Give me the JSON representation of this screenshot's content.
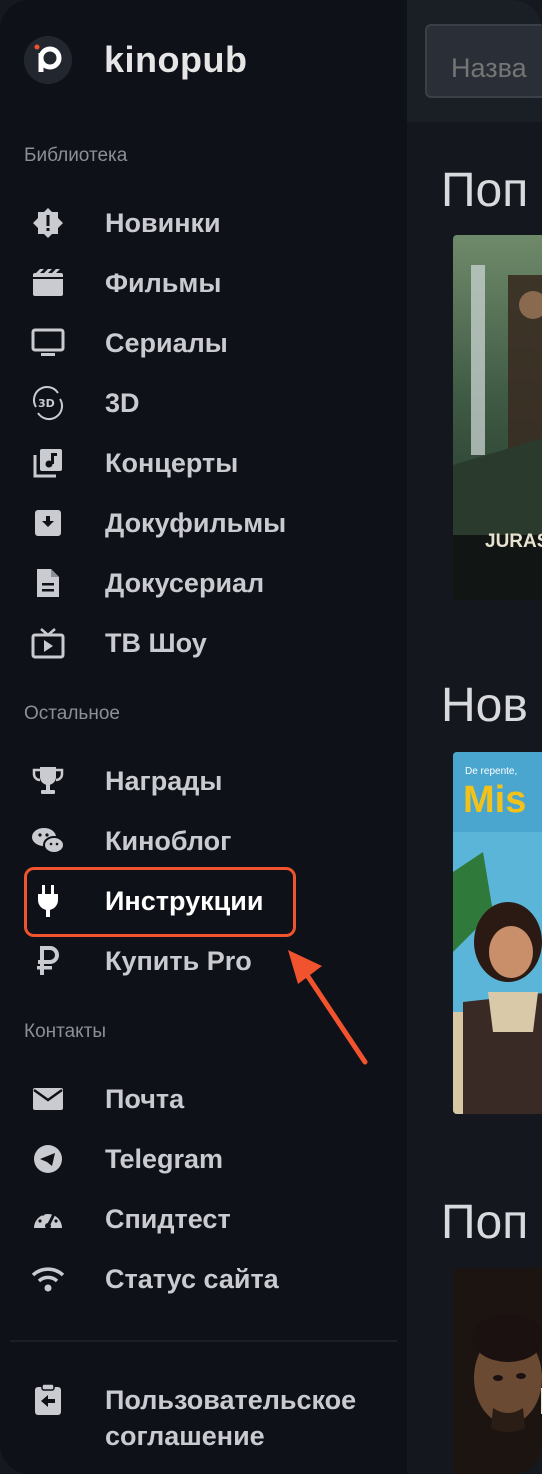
{
  "app": {
    "name": "kinopub"
  },
  "search": {
    "placeholder": "Назва"
  },
  "sections": {
    "library_title": "Библиотека",
    "other_title": "Остальное",
    "contacts_title": "Контакты"
  },
  "library": [
    {
      "label": "Новинки",
      "icon": "badge-alert-icon"
    },
    {
      "label": "Фильмы",
      "icon": "clapperboard-icon"
    },
    {
      "label": "Сериалы",
      "icon": "tv-monitor-icon"
    },
    {
      "label": "3D",
      "icon": "3d-rotate-icon"
    },
    {
      "label": "Концерты",
      "icon": "music-library-icon"
    },
    {
      "label": "Докуфильмы",
      "icon": "archive-box-icon"
    },
    {
      "label": "Докусериал",
      "icon": "document-icon"
    },
    {
      "label": "ТВ Шоу",
      "icon": "tv-play-icon"
    }
  ],
  "other": [
    {
      "label": "Награды",
      "icon": "trophy-icon"
    },
    {
      "label": "Киноблог",
      "icon": "chat-bubbles-icon"
    },
    {
      "label": "Инструкции",
      "icon": "plug-icon",
      "active": true
    },
    {
      "label": "Купить Pro",
      "icon": "ruble-icon"
    }
  ],
  "contacts": [
    {
      "label": "Почта",
      "icon": "mail-icon"
    },
    {
      "label": "Telegram",
      "icon": "telegram-icon"
    },
    {
      "label": "Спидтест",
      "icon": "speedometer-icon"
    },
    {
      "label": "Статус сайта",
      "icon": "wifi-icon"
    }
  ],
  "footer": {
    "agreement": "Пользовательское соглашение",
    "icon": "clipboard-return-icon"
  },
  "content": {
    "headings": [
      "Поп",
      "Нов",
      "Поп"
    ],
    "poster_texts": [
      "JURAS",
      "De repente,",
      "Mis"
    ]
  },
  "colors": {
    "sidebar_bg": "#0e1117",
    "main_bg": "#14171e",
    "highlight": "#f0532d",
    "text": "#c9cbd0"
  }
}
